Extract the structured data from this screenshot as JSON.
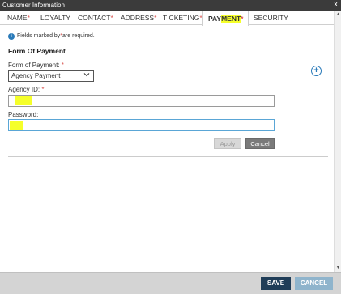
{
  "window": {
    "title": "Customer Information",
    "close_glyph": "x"
  },
  "tabs": [
    {
      "label": "NAME",
      "required": "*"
    },
    {
      "label": "LOYALTY",
      "required": ""
    },
    {
      "label": "CONTACT",
      "required": "*"
    },
    {
      "label": "ADDRESS",
      "required": "*"
    },
    {
      "label": "TICKETING",
      "required": "*"
    },
    {
      "label_pre": "PAY",
      "label_hl": "MENT",
      "required": "*"
    },
    {
      "label": "SECURITY",
      "required": ""
    }
  ],
  "info": {
    "icon": "info-icon",
    "text_before": "Fields marked by ",
    "asterisk": "*",
    "text_after": " are required."
  },
  "form": {
    "section_title": "Form Of Payment",
    "form_of_payment": {
      "label": "Form of Payment: ",
      "required": "*",
      "selected": "Agency Payment"
    },
    "agency_id": {
      "label": "Agency ID: ",
      "required": "*",
      "value": ""
    },
    "password": {
      "label": "Password:",
      "value": ""
    },
    "apply_label": "Apply",
    "cancel_label": "Cancel",
    "add_icon": "plus-circle-icon"
  },
  "footer": {
    "save_label": "SAVE",
    "cancel_label": "CANCEL"
  },
  "colors": {
    "titlebar": "#3b3b3b",
    "accent": "#2a7ab9",
    "highlight": "#f5ff2a",
    "save": "#1f3d58",
    "cancel": "#8fb4cc",
    "required": "#d9534f"
  }
}
